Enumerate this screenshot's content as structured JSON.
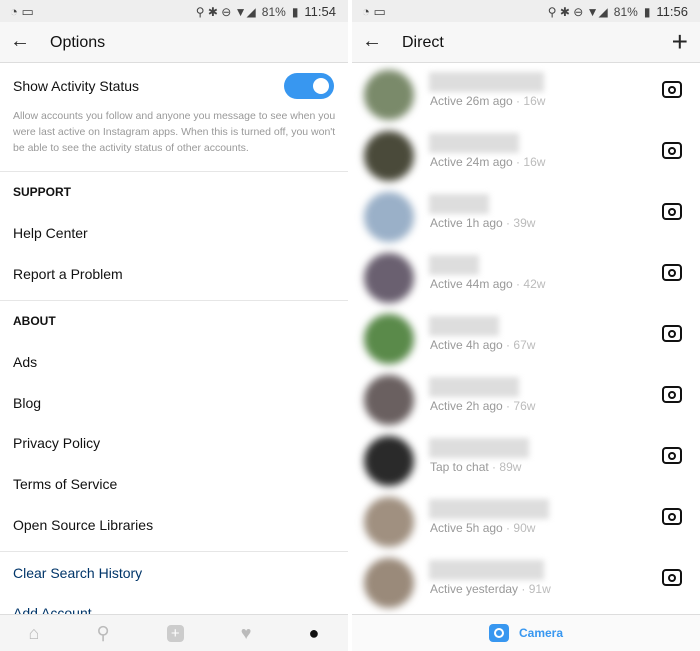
{
  "left": {
    "status": {
      "battery": "81%",
      "time": "11:54"
    },
    "header": {
      "title": "Options"
    },
    "activity": {
      "label": "Show Activity Status",
      "enabled": true,
      "description": "Allow accounts you follow and anyone you message to see when you were last active on Instagram apps. When this is turned off, you won't be able to see the activity status of other accounts."
    },
    "support": {
      "heading": "SUPPORT",
      "items": [
        "Help Center",
        "Report a Problem"
      ]
    },
    "about": {
      "heading": "ABOUT",
      "items": [
        "Ads",
        "Blog",
        "Privacy Policy",
        "Terms of Service",
        "Open Source Libraries"
      ]
    },
    "links": [
      "Clear Search History",
      "Add Account"
    ],
    "nav": [
      "home-icon",
      "search-icon",
      "add-icon",
      "heart-icon",
      "profile-icon"
    ]
  },
  "right": {
    "status": {
      "battery": "81%",
      "time": "11:56"
    },
    "header": {
      "title": "Direct"
    },
    "threads": [
      {
        "status": "Active 26m ago",
        "age": "16w",
        "color": "#7a8a6a"
      },
      {
        "status": "Active 24m ago",
        "age": "16w",
        "color": "#4a4a3a"
      },
      {
        "status": "Active 1h ago",
        "age": "39w",
        "color": "#9ab0c8"
      },
      {
        "status": "Active 44m ago",
        "age": "42w",
        "color": "#6a6070"
      },
      {
        "status": "Active 4h ago",
        "age": "67w",
        "color": "#5a8a4a"
      },
      {
        "status": "Active 2h ago",
        "age": "76w",
        "color": "#6a6060"
      },
      {
        "status": "Tap to chat",
        "age": "89w",
        "color": "#2a2a2a"
      },
      {
        "status": "Active 5h ago",
        "age": "90w",
        "color": "#a09080"
      },
      {
        "status": "Active yesterday",
        "age": "91w",
        "color": "#9a8a7a"
      }
    ],
    "bottom": {
      "label": "Camera"
    }
  }
}
